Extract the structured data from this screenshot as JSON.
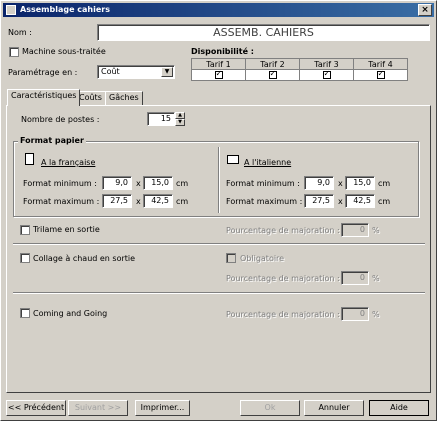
{
  "window": {
    "title": "Assemblage cahiers",
    "close": "×"
  },
  "header": {
    "nom_label": "Nom :",
    "nom_value": "ASSEMB. CAHIERS",
    "machine_label": "Machine sous-traitée",
    "parametrage_label": "Paramétrage en :",
    "parametrage_value": "Coût",
    "disponibilite_label": "Disponibilité :",
    "tarifs": [
      {
        "label": "Tarif 1",
        "checked": true
      },
      {
        "label": "Tarif 2",
        "checked": true
      },
      {
        "label": "Tarif 3",
        "checked": true
      },
      {
        "label": "Tarif 4",
        "checked": true
      }
    ]
  },
  "tabs": [
    {
      "label": "Caractéristiques",
      "active": true
    },
    {
      "label": "Coûts",
      "active": false
    },
    {
      "label": "Gâches",
      "active": false
    }
  ],
  "caracteristiques": {
    "nombre_postes_label": "Nombre de postes :",
    "nombre_postes_value": "15",
    "format_papier_title": "Format papier",
    "francaise": {
      "label": "A la française",
      "min_label": "Format minimum :",
      "min_w": "9,0",
      "min_h": "15,0",
      "max_label": "Format maximum :",
      "max_w": "27,5",
      "max_h": "42,5",
      "sep": "x",
      "unit": "cm"
    },
    "italienne": {
      "label": "A l'italienne",
      "min_label": "Format minimum :",
      "min_w": "9,0",
      "min_h": "15,0",
      "max_label": "Format maximum :",
      "max_w": "27,5",
      "max_h": "42,5",
      "sep": "x",
      "unit": "cm"
    },
    "trilame_label": "Trilame en sortie",
    "collage_label": "Collage à chaud en sortie",
    "coming_label": "Coming and Going",
    "obligatoire_label": "Obligatoire",
    "pourcentage_label": "Pourcentage de majoration :",
    "pct_trilame": "0",
    "pct_collage": "0",
    "pct_coming": "0",
    "pct_unit": "%"
  },
  "footer": {
    "precedent": "<< Précédent",
    "suivant": "Suivant >>",
    "imprimer": "Imprimer...",
    "ok": "Ok",
    "annuler": "Annuler",
    "aide": "Aide"
  }
}
